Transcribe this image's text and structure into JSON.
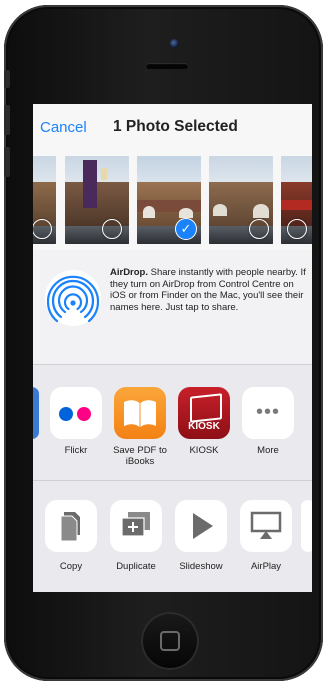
{
  "header": {
    "cancel_label": "Cancel",
    "title": "1 Photo Selected"
  },
  "airdrop": {
    "heading": "AirDrop.",
    "description": " Share instantly with people nearby. If they turn on AirDrop from Control Centre on iOS or from Finder on the Mac, you'll see their names here. Just tap to share."
  },
  "apps": [
    {
      "label": "Flickr"
    },
    {
      "label": "Save PDF to iBooks"
    },
    {
      "label": "KIOSK",
      "icon_text": "KIOSK"
    },
    {
      "label": "More"
    }
  ],
  "actions": [
    {
      "label": "Copy"
    },
    {
      "label": "Duplicate"
    },
    {
      "label": "Slideshow"
    },
    {
      "label": "AirPlay"
    }
  ],
  "colors": {
    "accent": "#1a82fb",
    "flickr_blue": "#0063dc",
    "flickr_pink": "#ff0084",
    "ibooks_orange": "#f7901e",
    "kiosk_red": "#b4141e"
  }
}
